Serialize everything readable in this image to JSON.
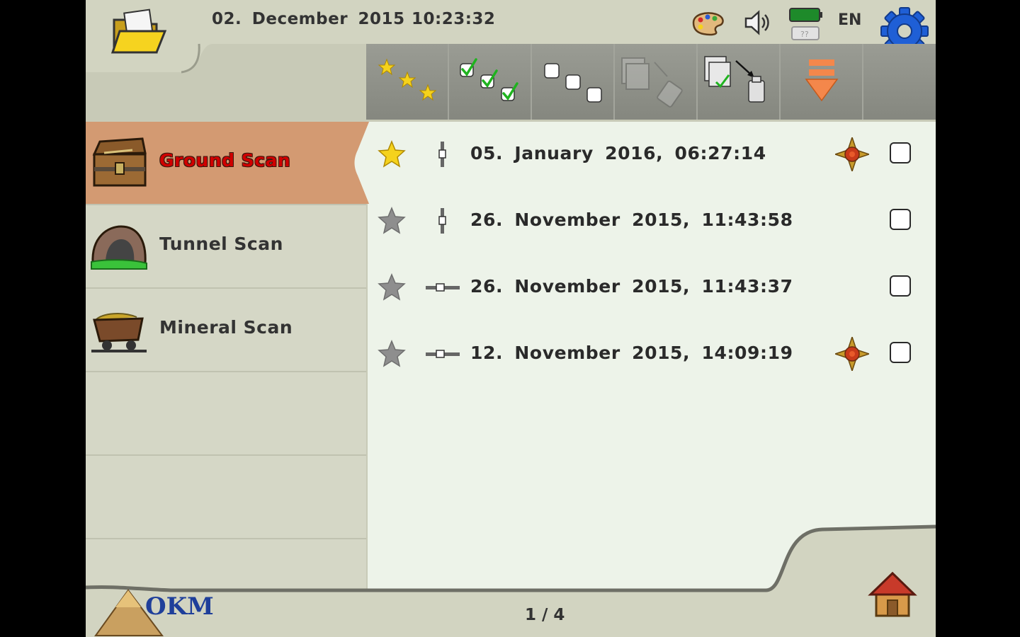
{
  "header": {
    "date": "02. December 2015",
    "time": "10:23:32",
    "language": "EN",
    "icons": [
      "folder-icon",
      "palette-icon",
      "speaker-icon",
      "battery-icon",
      "gear-icon"
    ]
  },
  "toolbar": {
    "buttons": [
      "select-favorites-icon",
      "select-all-icon",
      "deselect-all-icon",
      "delete-scans-icon",
      "export-scans-icon",
      "scroll-down-icon"
    ]
  },
  "sidebar": {
    "items": [
      {
        "label": "Ground Scan",
        "icon": "treasure-chest-icon",
        "active": true
      },
      {
        "label": "Tunnel Scan",
        "icon": "tunnel-icon",
        "active": false
      },
      {
        "label": "Mineral Scan",
        "icon": "mine-cart-icon",
        "active": false
      }
    ]
  },
  "scans": [
    {
      "date": "05. January 2016, 06:27:14",
      "favorite": true,
      "orientation": "vertical",
      "has_target": true,
      "checked": false
    },
    {
      "date": "26. November 2015, 11:43:58",
      "favorite": false,
      "orientation": "vertical",
      "has_target": false,
      "checked": false
    },
    {
      "date": "26. November 2015, 11:43:37",
      "favorite": false,
      "orientation": "horizontal",
      "has_target": false,
      "checked": false
    },
    {
      "date": "12. November 2015, 14:09:19",
      "favorite": false,
      "orientation": "horizontal",
      "has_target": true,
      "checked": false
    }
  ],
  "footer": {
    "logo_text": "OKM",
    "page_indicator": "1 / 4"
  },
  "colors": {
    "active_item": "#d39a72",
    "active_label": "#d00000",
    "star_favorite": "#f5d21c",
    "star_default": "#8e8e8e",
    "accent_blue": "#1f5fd6"
  }
}
